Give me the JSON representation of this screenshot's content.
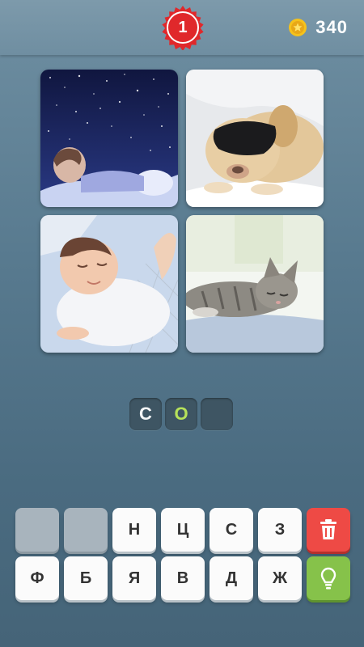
{
  "header": {
    "level": "1",
    "coins": "340",
    "level_badge_color": "#e0282b",
    "coin_color": "#f5c21b"
  },
  "puzzle": {
    "images": [
      {
        "icon": "starry-night-child-sleeping"
      },
      {
        "icon": "dog-sleeping-eye-mask"
      },
      {
        "icon": "baby-sleeping"
      },
      {
        "icon": "cat-sleeping"
      }
    ],
    "answer_slots": [
      {
        "letter": "С",
        "state": "placed",
        "color": "#ffffff"
      },
      {
        "letter": "О",
        "state": "hint",
        "color": "#b6e25a"
      },
      {
        "letter": "",
        "state": "empty"
      }
    ]
  },
  "keyboard": {
    "row1": [
      {
        "letter": "",
        "state": "used"
      },
      {
        "letter": "",
        "state": "used"
      },
      {
        "letter": "Н"
      },
      {
        "letter": "Ц"
      },
      {
        "letter": "С"
      },
      {
        "letter": "З"
      },
      {
        "icon": "trash-icon",
        "color": "#ee4a45"
      }
    ],
    "row2": [
      {
        "letter": "Ф"
      },
      {
        "letter": "Б"
      },
      {
        "letter": "Я"
      },
      {
        "letter": "В"
      },
      {
        "letter": "Д"
      },
      {
        "letter": "Ж"
      },
      {
        "icon": "lightbulb-icon",
        "color": "#86c24a"
      }
    ]
  }
}
